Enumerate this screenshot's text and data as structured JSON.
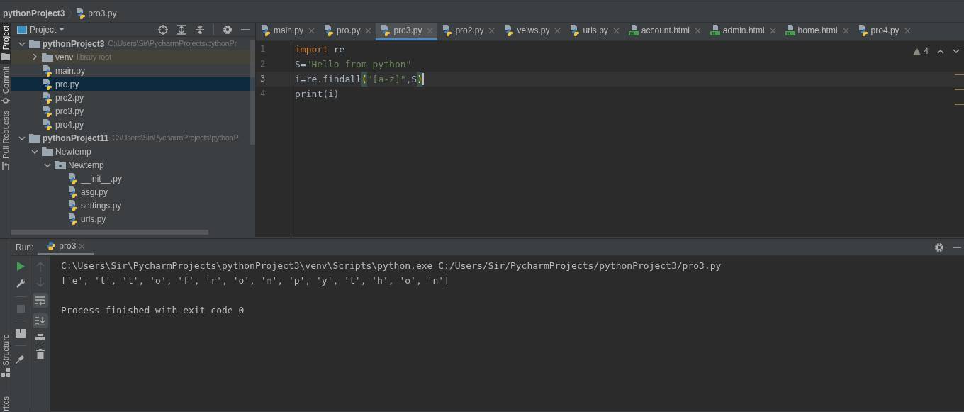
{
  "breadcrumbs": [
    {
      "label": "pythonProject3",
      "kind": "project"
    },
    {
      "label": "pro3.py",
      "kind": "python"
    }
  ],
  "side_strip": {
    "top": [
      {
        "label": "Project",
        "kind": "folder",
        "selected": true
      },
      {
        "label": "Commit",
        "kind": "commit",
        "selected": false
      },
      {
        "label": "Pull Requests",
        "kind": "pull",
        "selected": false
      }
    ],
    "bottom": [
      {
        "label": "Structure",
        "kind": "structure",
        "selected": false
      },
      {
        "label": "rites",
        "kind": "none",
        "selected": false
      }
    ]
  },
  "project_panel": {
    "title": "Project",
    "tree": [
      {
        "name": "pythonProject3",
        "hint": "C:\\Users\\Sir\\PycharmProjects\\pythonPr",
        "kind": "project",
        "expanded": true,
        "selected": false,
        "children": [
          {
            "name": "venv",
            "hint": "library root",
            "kind": "library",
            "expanded": false,
            "selected": false
          },
          {
            "name": "main.py",
            "kind": "python",
            "selected": false
          },
          {
            "name": "pro.py",
            "kind": "python",
            "selected": true
          },
          {
            "name": "pro2.py",
            "kind": "python",
            "selected": false
          },
          {
            "name": "pro3.py",
            "kind": "python",
            "selected": false
          },
          {
            "name": "pro4.py",
            "kind": "python",
            "selected": false
          }
        ]
      },
      {
        "name": "pythonProject11",
        "hint": "C:\\Users\\Sir\\PycharmProjects\\pythonP",
        "kind": "project",
        "expanded": true,
        "selected": false,
        "children": [
          {
            "name": "Newtemp",
            "kind": "folder",
            "expanded": true,
            "selected": false,
            "children": [
              {
                "name": "Newtemp",
                "kind": "package",
                "expanded": true,
                "selected": false,
                "children": [
                  {
                    "name": "__init__.py",
                    "kind": "python",
                    "selected": false
                  },
                  {
                    "name": "asgi.py",
                    "kind": "python",
                    "selected": false
                  },
                  {
                    "name": "settings.py",
                    "kind": "python",
                    "selected": false
                  },
                  {
                    "name": "urls.py",
                    "kind": "python",
                    "selected": false
                  }
                ]
              }
            ]
          }
        ]
      }
    ]
  },
  "tabs": [
    {
      "label": "main.py",
      "kind": "python",
      "selected": false
    },
    {
      "label": "pro.py",
      "kind": "python",
      "selected": false
    },
    {
      "label": "pro3.py",
      "kind": "python",
      "selected": true
    },
    {
      "label": "pro2.py",
      "kind": "python",
      "selected": false
    },
    {
      "label": "veiws.py",
      "kind": "python",
      "selected": false
    },
    {
      "label": "urls.py",
      "kind": "python",
      "selected": false
    },
    {
      "label": "account.html",
      "kind": "html",
      "selected": false
    },
    {
      "label": "admin.html",
      "kind": "html",
      "selected": false
    },
    {
      "label": "home.html",
      "kind": "html",
      "selected": false
    },
    {
      "label": "pro4.py",
      "kind": "python",
      "selected": false
    }
  ],
  "editor": {
    "warnings": "4",
    "lines": [
      {
        "number": "1",
        "current": false,
        "tokens": [
          {
            "text": "import",
            "kind": "keyword"
          },
          {
            "text": " re",
            "kind": "plain"
          }
        ]
      },
      {
        "number": "2",
        "current": false,
        "tokens": [
          {
            "text": "S=",
            "kind": "plain"
          },
          {
            "text": "\"Hello from python\"",
            "kind": "string"
          }
        ]
      },
      {
        "number": "3",
        "current": true,
        "tokens": [
          {
            "text": "i=re.findall",
            "kind": "plain"
          },
          {
            "text": "(",
            "kind": "match"
          },
          {
            "text": "\"[a-z]\"",
            "kind": "string"
          },
          {
            "text": ",S",
            "kind": "plain"
          },
          {
            "text": ")",
            "kind": "match"
          }
        ]
      },
      {
        "number": "4",
        "current": false,
        "tokens": [
          {
            "text": "print(i)",
            "kind": "plain"
          }
        ]
      }
    ]
  },
  "run_panel": {
    "label": "Run:",
    "tab": "pro3",
    "output": [
      {
        "text": "C:\\Users\\Sir\\PycharmProjects\\pythonProject3\\venv\\Scripts\\python.exe C:/Users/Sir/PycharmProjects/pythonProject3/pro3.py",
        "kind": "command"
      },
      {
        "text": "['e', 'l', 'l', 'o', 'f', 'r', 'o', 'm', 'p', 'y', 't', 'h', 'o', 'n']",
        "kind": "output"
      },
      {
        "text": "Process finished with exit code 0",
        "kind": "status"
      }
    ]
  }
}
